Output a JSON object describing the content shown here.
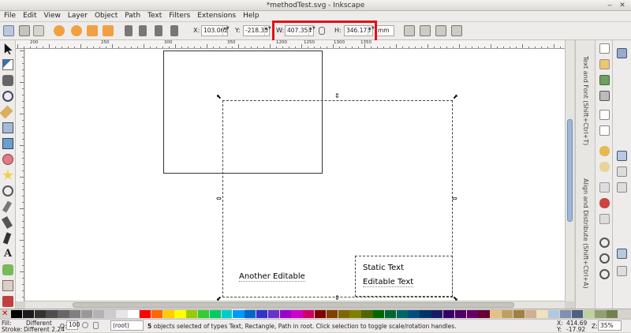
{
  "window": {
    "title": "*methodTest.svg - Inkscape",
    "min_glyph": "‒",
    "close_glyph": "✕"
  },
  "menu": [
    "File",
    "Edit",
    "View",
    "Layer",
    "Object",
    "Path",
    "Text",
    "Filters",
    "Extensions",
    "Help"
  ],
  "toolbar": {
    "x_label": "X:",
    "x_value": "103.062",
    "y_label": "Y:",
    "y_value": "-218.35",
    "w_label": "W:",
    "w_value": "407.354",
    "h_label": "H:",
    "h_value": "346.175",
    "unit": "mm",
    "spin_arrows": "▲▼"
  },
  "ruler": {
    "labels": [
      "200",
      "250",
      "300",
      "350",
      "1200",
      "1250",
      "1300",
      "1350"
    ]
  },
  "canvas": {
    "texts": {
      "another_editable": "Another Editable",
      "static_text": "Static Text",
      "editable_text": "Editable Text"
    },
    "handles": {
      "corner": "⬉",
      "side_v": "⇕",
      "side_h": "⇔"
    }
  },
  "dock": {
    "tab_text": "Text and Font (Shift+Ctrl+T)",
    "tab_align": "Align and Distribute (Shift+Ctrl+A)"
  },
  "palette": {
    "none_glyph": "✕",
    "colors": [
      "#000000",
      "#1a1a1a",
      "#333333",
      "#4d4d4d",
      "#666666",
      "#808080",
      "#999999",
      "#b3b3b3",
      "#cccccc",
      "#e6e6e6",
      "#ffffff",
      "#ff0000",
      "#ff6600",
      "#ffcc00",
      "#ffff00",
      "#99cc00",
      "#33cc33",
      "#00cc66",
      "#00cccc",
      "#0099ff",
      "#0066cc",
      "#3333cc",
      "#6633cc",
      "#9900cc",
      "#cc00cc",
      "#cc0066",
      "#800000",
      "#804000",
      "#806600",
      "#808000",
      "#4d6600",
      "#006600",
      "#006633",
      "#006666",
      "#004d80",
      "#003366",
      "#1a1a66",
      "#330066",
      "#4d0066",
      "#660066",
      "#660033",
      "#e5c080",
      "#c0a060",
      "#a08040",
      "#d0b090",
      "#f0e0c0",
      "#b0c8e0",
      "#8090b0",
      "#506080",
      "#c0d0a0",
      "#90a070",
      "#708050"
    ],
    "selected_index": 19
  },
  "status": {
    "fill_label": "Fill:",
    "fill_value": "Different",
    "stroke_label": "Stroke:",
    "stroke_value": "Different 2.24",
    "opacity_label": "O:",
    "opacity_value": "100",
    "layer_value": "(root)",
    "message_bold": "5",
    "message": " objects selected of types Text, Rectangle, Path in root. Click selection to toggle scale/rotation handles.",
    "x_label": "X:",
    "x_value": "414.69",
    "y_label": "Y:",
    "y_value": "-17.92",
    "zoom_label": "Z:",
    "zoom_value": "35%"
  },
  "colors": {
    "highlight": "#e0101a",
    "canvas": "#ffffff",
    "chrome": "#edeceb"
  }
}
